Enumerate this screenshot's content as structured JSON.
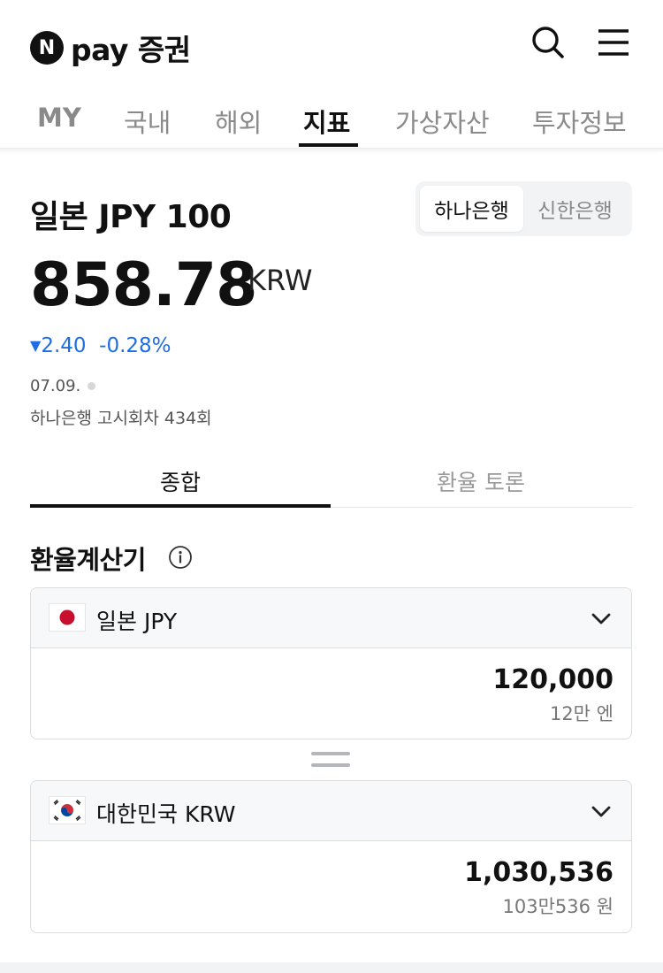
{
  "header": {
    "logo_badge": "N",
    "logo_text": "pay 증권"
  },
  "nav": {
    "items": [
      {
        "label": "MY"
      },
      {
        "label": "국내"
      },
      {
        "label": "해외"
      },
      {
        "label": "지표"
      },
      {
        "label": "가상자산"
      },
      {
        "label": "투자정보"
      }
    ],
    "active_index": 3
  },
  "currency": {
    "title": "일본 JPY 100",
    "banks": [
      {
        "label": "하나은행",
        "selected": true
      },
      {
        "label": "신한은행",
        "selected": false
      }
    ],
    "price": "858.78",
    "unit": "KRW",
    "change_arrow": "▼",
    "change_value": "2.40",
    "change_percent": "-0.28%",
    "change_color": "#1d6ee6",
    "date": "07.09.",
    "round_info": "하나은행 고시회차 434회"
  },
  "content_tabs": {
    "items": [
      {
        "label": "종합",
        "active": true
      },
      {
        "label": "환율 토론",
        "active": false
      }
    ]
  },
  "calculator": {
    "title": "환율계산기",
    "from": {
      "flag": "japan-flag-icon",
      "label": "일본 JPY",
      "amount": "120,000",
      "amount_text": "12만 엔"
    },
    "to": {
      "flag": "korea-flag-icon",
      "label": "대한민국 KRW",
      "amount": "1,030,536",
      "amount_text": "103만536 원"
    }
  }
}
